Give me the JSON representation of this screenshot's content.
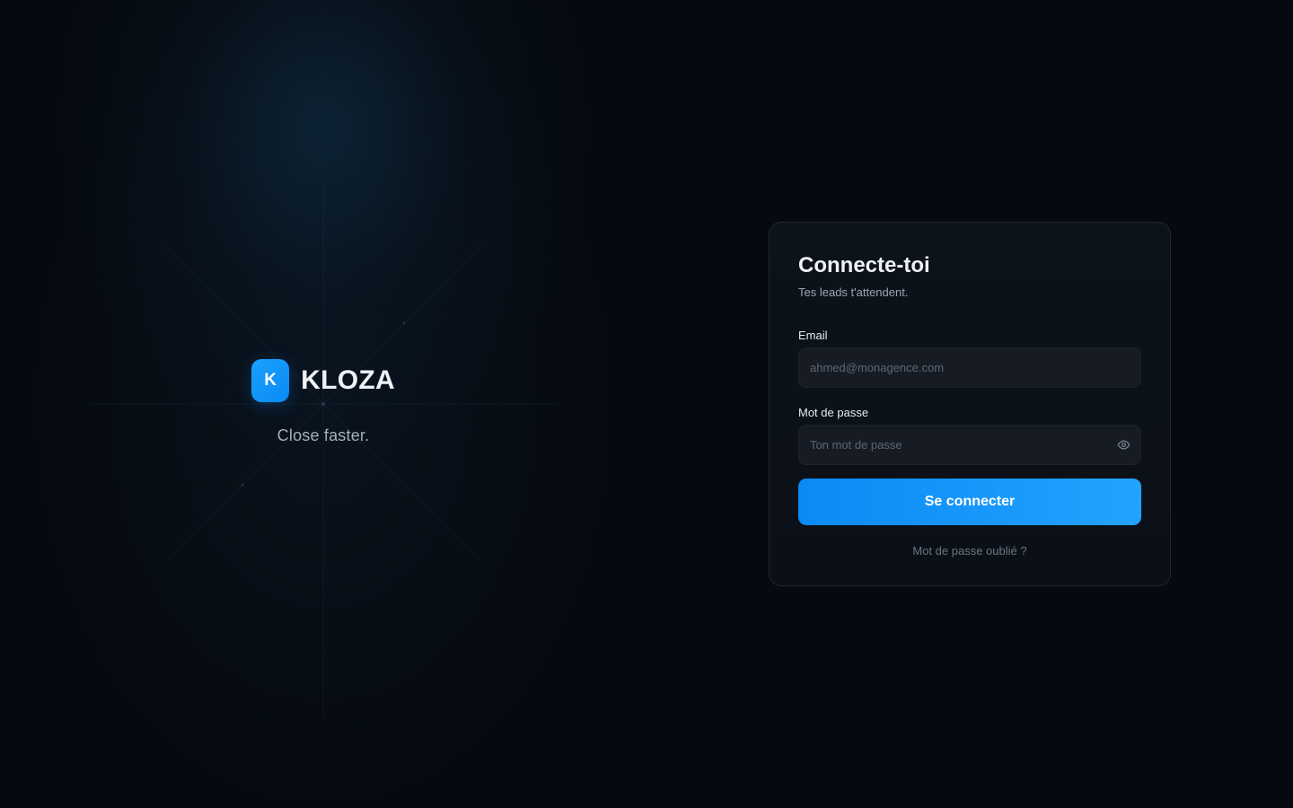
{
  "brand": {
    "logo_letter": "K",
    "name": "KLOZA",
    "tagline": "Close faster.",
    "accent_color": "#0b8af5"
  },
  "login": {
    "title": "Connecte-toi",
    "subtitle": "Tes leads t'attendent.",
    "email": {
      "label": "Email",
      "value": "",
      "placeholder": "ahmed@monagence.com"
    },
    "password": {
      "label": "Mot de passe",
      "value": "",
      "placeholder": "Ton mot de passe",
      "toggle_icon": "eye-icon"
    },
    "submit_label": "Se connecter",
    "forgot_label": "Mot de passe oublié ?"
  }
}
